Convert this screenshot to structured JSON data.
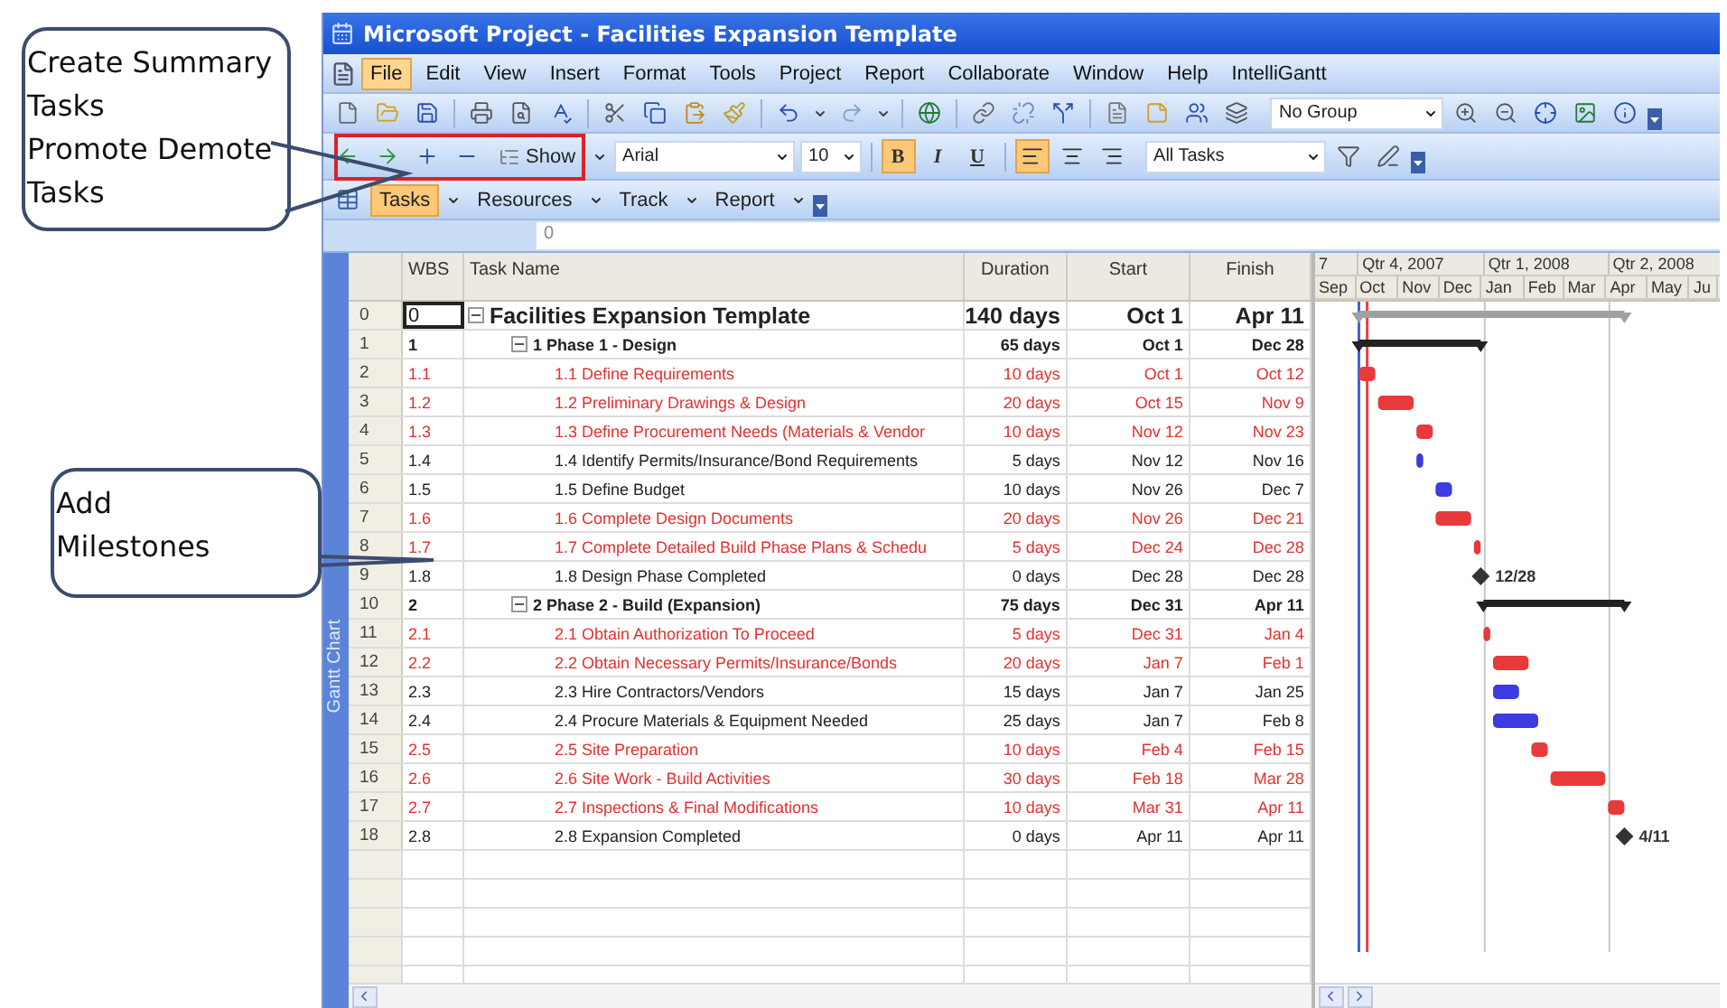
{
  "window": {
    "title": "Microsoft Project - Facilities Expansion Template"
  },
  "menu": [
    {
      "label": "File",
      "selected": true
    },
    {
      "label": "Edit",
      "selected": false
    },
    {
      "label": "View",
      "selected": false
    },
    {
      "label": "Insert",
      "selected": false
    },
    {
      "label": "Format",
      "selected": false
    },
    {
      "label": "Tools",
      "selected": false
    },
    {
      "label": "Project",
      "selected": false
    },
    {
      "label": "Report",
      "selected": false
    },
    {
      "label": "Collaborate",
      "selected": false
    },
    {
      "label": "Window",
      "selected": false
    },
    {
      "label": "Help",
      "selected": false
    },
    {
      "label": "IntelliGantt",
      "selected": false
    }
  ],
  "standard_toolbar": {
    "group": "No Group"
  },
  "formatting_toolbar": {
    "show_label": "Show",
    "font": "Arial",
    "size": "10",
    "styles": [
      {
        "label": "B",
        "kind": "bold",
        "on": true
      },
      {
        "label": "I",
        "kind": "italic",
        "on": false
      },
      {
        "label": "U",
        "kind": "underline",
        "on": false
      }
    ],
    "alignment": [
      {
        "kind": "left",
        "on": true
      },
      {
        "kind": "center",
        "on": false
      },
      {
        "kind": "right",
        "on": false
      }
    ],
    "filter": "All Tasks"
  },
  "guide_toolbar": [
    {
      "label": "Tasks",
      "selected": true
    },
    {
      "label": "Resources",
      "selected": false
    },
    {
      "label": "Track",
      "selected": false
    },
    {
      "label": "Report",
      "selected": false
    }
  ],
  "entry_bar": {
    "value": "0"
  },
  "view_label": "Gantt Chart",
  "table": {
    "columns": [
      "WBS",
      "Task Name",
      "Duration",
      "Start",
      "Finish"
    ]
  },
  "tasks": [
    {
      "id": "0",
      "wbs": "0",
      "name": "Facilities Expansion Template",
      "duration": "140 days",
      "start": "Oct 1",
      "finish": "Apr 11",
      "kind": "project",
      "critical": false,
      "selected": true,
      "expanded": true,
      "children": [
        {
          "id": "1",
          "wbs": "1",
          "name": "1 Phase 1 - Design",
          "duration": "65 days",
          "start": "Oct 1",
          "finish": "Dec 28",
          "kind": "summary",
          "critical": false,
          "selected": false,
          "expanded": true,
          "children": [
            {
              "id": "2",
              "wbs": "1.1",
              "name": "1.1 Define Requirements",
              "duration": "10 days",
              "start": "Oct 1",
              "finish": "Oct 12",
              "kind": "task",
              "critical": true,
              "selected": false
            },
            {
              "id": "3",
              "wbs": "1.2",
              "name": "1.2 Preliminary Drawings & Design",
              "duration": "20 days",
              "start": "Oct 15",
              "finish": "Nov 9",
              "kind": "task",
              "critical": true,
              "selected": false
            },
            {
              "id": "4",
              "wbs": "1.3",
              "name": "1.3 Define Procurement Needs (Materials & Vendor",
              "duration": "10 days",
              "start": "Nov 12",
              "finish": "Nov 23",
              "kind": "task",
              "critical": true,
              "selected": false
            },
            {
              "id": "5",
              "wbs": "1.4",
              "name": "1.4 Identify Permits/Insurance/Bond Requirements",
              "duration": "5 days",
              "start": "Nov 12",
              "finish": "Nov 16",
              "kind": "task",
              "critical": false,
              "selected": false
            },
            {
              "id": "6",
              "wbs": "1.5",
              "name": "1.5 Define Budget",
              "duration": "10 days",
              "start": "Nov 26",
              "finish": "Dec 7",
              "kind": "task",
              "critical": false,
              "selected": false
            },
            {
              "id": "7",
              "wbs": "1.6",
              "name": "1.6 Complete Design Documents",
              "duration": "20 days",
              "start": "Nov 26",
              "finish": "Dec 21",
              "kind": "task",
              "critical": true,
              "selected": false
            },
            {
              "id": "8",
              "wbs": "1.7",
              "name": "1.7 Complete Detailed Build Phase Plans & Schedu",
              "duration": "5 days",
              "start": "Dec 24",
              "finish": "Dec 28",
              "kind": "task",
              "critical": true,
              "selected": false
            },
            {
              "id": "9",
              "wbs": "1.8",
              "name": "1.8 Design Phase Completed",
              "duration": "0 days",
              "start": "Dec 28",
              "finish": "Dec 28",
              "kind": "milestone",
              "critical": false,
              "selected": false,
              "date_label": "12/28"
            }
          ]
        },
        {
          "id": "10",
          "wbs": "2",
          "name": "2 Phase 2 - Build (Expansion)",
          "duration": "75 days",
          "start": "Dec 31",
          "finish": "Apr 11",
          "kind": "summary",
          "critical": false,
          "selected": false,
          "expanded": true,
          "children": [
            {
              "id": "11",
              "wbs": "2.1",
              "name": "2.1 Obtain Authorization To Proceed",
              "duration": "5 days",
              "start": "Dec 31",
              "finish": "Jan 4",
              "kind": "task",
              "critical": true,
              "selected": false
            },
            {
              "id": "12",
              "wbs": "2.2",
              "name": "2.2 Obtain Necessary Permits/Insurance/Bonds",
              "duration": "20 days",
              "start": "Jan 7",
              "finish": "Feb 1",
              "kind": "task",
              "critical": true,
              "selected": false
            },
            {
              "id": "13",
              "wbs": "2.3",
              "name": "2.3 Hire Contractors/Vendors",
              "duration": "15 days",
              "start": "Jan 7",
              "finish": "Jan 25",
              "kind": "task",
              "critical": false,
              "selected": false
            },
            {
              "id": "14",
              "wbs": "2.4",
              "name": "2.4 Procure Materials & Equipment Needed",
              "duration": "25 days",
              "start": "Jan 7",
              "finish": "Feb 8",
              "kind": "task",
              "critical": false,
              "selected": false
            },
            {
              "id": "15",
              "wbs": "2.5",
              "name": "2.5 Site Preparation",
              "duration": "10 days",
              "start": "Feb 4",
              "finish": "Feb 15",
              "kind": "task",
              "critical": true,
              "selected": false
            },
            {
              "id": "16",
              "wbs": "2.6",
              "name": "2.6 Site Work - Build Activities",
              "duration": "30 days",
              "start": "Feb 18",
              "finish": "Mar 28",
              "kind": "task",
              "critical": true,
              "selected": false
            },
            {
              "id": "17",
              "wbs": "2.7",
              "name": "2.7 Inspections & Final Modifications",
              "duration": "10 days",
              "start": "Mar 31",
              "finish": "Apr 11",
              "kind": "task",
              "critical": true,
              "selected": false
            },
            {
              "id": "18",
              "wbs": "2.8",
              "name": "2.8 Expansion Completed",
              "duration": "0 days",
              "start": "Apr 11",
              "finish": "Apr 11",
              "kind": "milestone",
              "critical": false,
              "selected": false,
              "date_label": "4/11"
            }
          ]
        }
      ]
    }
  ],
  "gantt": {
    "quarters": [
      "7",
      "Qtr 4, 2007",
      "Qtr 1, 2008",
      "Qtr 2, 2008"
    ],
    "months": [
      "Sep",
      "Oct",
      "Nov",
      "Dec",
      "Jan",
      "Feb",
      "Mar",
      "Apr",
      "May",
      "Ju"
    ]
  },
  "callouts": [
    {
      "items": [
        "Create Summary Tasks",
        "Promote Demote Tasks"
      ]
    },
    {
      "items": [
        "Add Milestones"
      ]
    }
  ]
}
